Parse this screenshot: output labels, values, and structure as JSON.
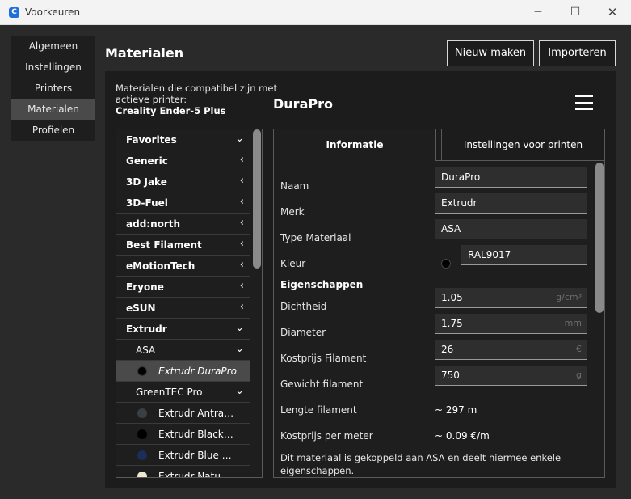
{
  "window": {
    "title": "Voorkeuren",
    "icon_letter": "C",
    "controls": {
      "minimize": "─",
      "maximize": "☐",
      "close": "✕"
    }
  },
  "sidebar": {
    "items": [
      {
        "label": "Algemeen",
        "active": false
      },
      {
        "label": "Instellingen",
        "active": false
      },
      {
        "label": "Printers",
        "active": false
      },
      {
        "label": "Materialen",
        "active": true
      },
      {
        "label": "Profielen",
        "active": false
      }
    ]
  },
  "header": {
    "title": "Materialen",
    "new_button": "Nieuw maken",
    "import_button": "Importeren"
  },
  "compat": {
    "text": "Materialen die compatibel zijn met actieve printer:",
    "printer": "Creality Ender-5 Plus"
  },
  "material_list": {
    "groups": [
      {
        "label": "Favorites",
        "chevron": "down"
      },
      {
        "label": "Generic",
        "chevron": "left"
      },
      {
        "label": "3D Jake",
        "chevron": "left"
      },
      {
        "label": "3D-Fuel",
        "chevron": "left"
      },
      {
        "label": "add:north",
        "chevron": "left"
      },
      {
        "label": "Best Filament",
        "chevron": "left"
      },
      {
        "label": "eMotionTech",
        "chevron": "left"
      },
      {
        "label": "Eryone",
        "chevron": "left"
      },
      {
        "label": "eSUN",
        "chevron": "left"
      },
      {
        "label": "Extrudr",
        "chevron": "down"
      }
    ],
    "subgroups": [
      {
        "label": "ASA",
        "items": [
          {
            "label": "Extrudr DuraPro",
            "color": "#000000",
            "selected": true
          }
        ]
      },
      {
        "label": "GreenTEC Pro",
        "items": [
          {
            "label": "Extrudr Antra…",
            "color": "#3a3f46",
            "selected": false
          },
          {
            "label": "Extrudr Black…",
            "color": "#000000",
            "selected": false
          },
          {
            "label": "Extrudr Blue …",
            "color": "#1d2d5a",
            "selected": false
          },
          {
            "label": "Extrudr Natu…",
            "color": "#efe9d0",
            "selected": false
          }
        ]
      }
    ]
  },
  "material": {
    "name": "DuraPro",
    "tabs": {
      "info": "Informatie",
      "print": "Instellingen voor printen"
    },
    "fields": {
      "name_label": "Naam",
      "name_value": "DuraPro",
      "brand_label": "Merk",
      "brand_value": "Extrudr",
      "type_label": "Type Materiaal",
      "type_value": "ASA",
      "color_label": "Kleur",
      "color_value": "RAL9017",
      "color_swatch": "#000000"
    },
    "properties_heading": "Eigenschappen",
    "properties": {
      "density_label": "Dichtheid",
      "density_value": "1.05",
      "density_unit": "g/cm³",
      "diameter_label": "Diameter",
      "diameter_value": "1.75",
      "diameter_unit": "mm",
      "cost_label": "Kostprijs Filament",
      "cost_value": "26",
      "cost_unit": "€",
      "weight_label": "Gewicht filament",
      "weight_value": "750",
      "weight_unit": "g",
      "length_label": "Lengte filament",
      "length_value": "~ 297 m",
      "cpm_label": "Kostprijs per meter",
      "cpm_value": "~ 0.09 €/m"
    },
    "note": "Dit materiaal is gekoppeld aan ASA en deelt hiermee enkele eigenschappen."
  }
}
